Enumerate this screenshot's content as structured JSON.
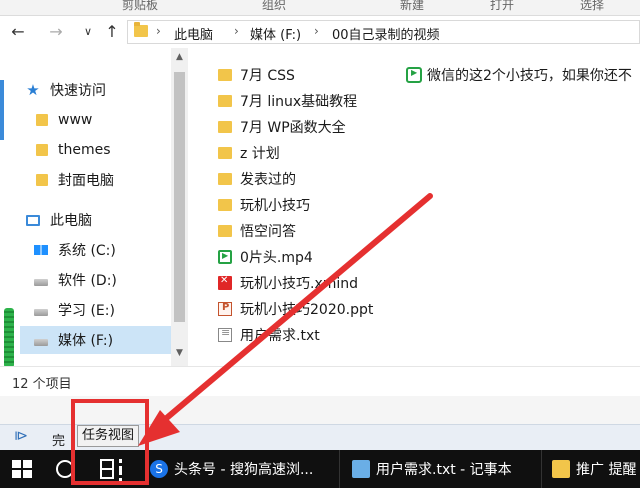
{
  "ribbon": {
    "labels": [
      "剪贴板",
      "组织",
      "新建",
      "打开",
      "选择"
    ]
  },
  "address": {
    "crumbs": [
      "此电脑",
      "媒体 (F:)",
      "00自己录制的视频"
    ]
  },
  "nav": {
    "quick_access": "快速访问",
    "pinned": [
      "www",
      "themes",
      "封面电脑"
    ],
    "this_pc": "此电脑",
    "drives": [
      "系统 (C:)",
      "软件 (D:)",
      "学习 (E:)",
      "媒体 (F:)"
    ]
  },
  "files": [
    {
      "name": "7月 CSS",
      "type": "folder"
    },
    {
      "name": "7月 linux基础教程",
      "type": "folder"
    },
    {
      "name": "7月 WP函数大全",
      "type": "folder"
    },
    {
      "name": "z 计划",
      "type": "folder"
    },
    {
      "name": "发表过的",
      "type": "folder"
    },
    {
      "name": "玩机小技巧",
      "type": "folder"
    },
    {
      "name": "悟空问答",
      "type": "folder"
    },
    {
      "name": "0片头.mp4",
      "type": "mp4"
    },
    {
      "name": "玩机小技巧.xmind",
      "type": "xmind"
    },
    {
      "name": "玩机小技巧2020.ppt",
      "type": "ppt"
    },
    {
      "name": "用户需求.txt",
      "type": "txt"
    }
  ],
  "wechat_file": "微信的这2个小技巧，如果你还不",
  "status": "12 个项目",
  "mediabar": {
    "done_label": "完"
  },
  "tooltip": "任务视图",
  "taskbar": {
    "apps": [
      {
        "label": "头条号 - 搜狗高速浏..."
      },
      {
        "label": "用户需求.txt - 记事本"
      },
      {
        "label": "推广 提醒"
      }
    ]
  },
  "colors": {
    "accent": "#3b8ad9",
    "annotation": "#e53030",
    "folder": "#f2c54a",
    "selection": "#cce4f7"
  }
}
